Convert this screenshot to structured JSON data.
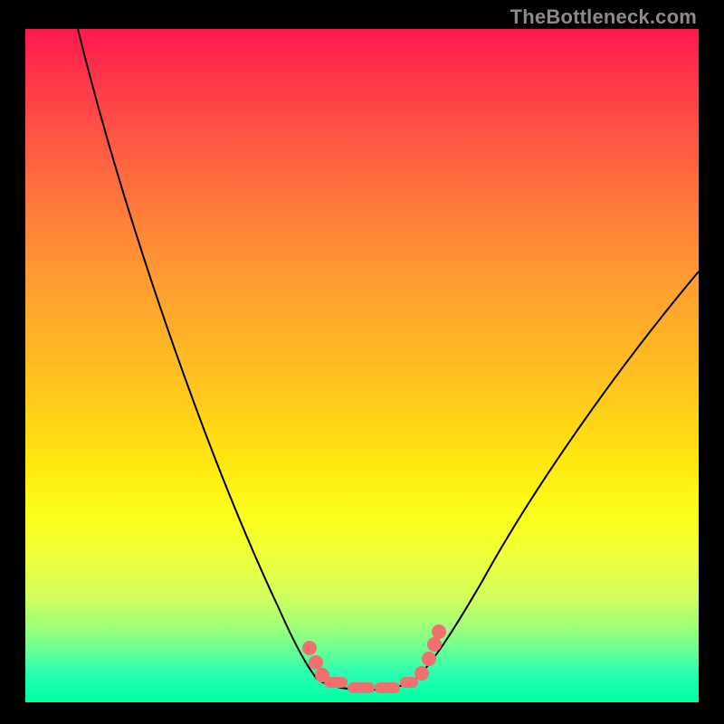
{
  "attribution": "TheBottleneck.com",
  "colors": {
    "dot": "#f07070",
    "curve": "#000000",
    "frame_border": "#000000"
  },
  "chart_data": {
    "type": "line",
    "title": "",
    "xlabel": "",
    "ylabel": "",
    "xlim": [
      0,
      100
    ],
    "ylim": [
      0,
      100
    ],
    "note": "Axes are not labeled in the source image; values are estimated on a 0–100 normalized scale where y is bottleneck percentage (0 = no bottleneck at bottom, 100 = severe at top).",
    "series": [
      {
        "name": "bottleneck-curve",
        "x": [
          8,
          12,
          16,
          20,
          24,
          28,
          32,
          36,
          40,
          42,
          44,
          46,
          50,
          54,
          58,
          60,
          62,
          66,
          72,
          80,
          90,
          100
        ],
        "y": [
          100,
          88,
          77,
          66,
          55,
          45,
          35,
          26,
          16,
          10,
          6,
          3,
          1,
          1,
          2,
          4,
          7,
          12,
          20,
          32,
          48,
          64
        ]
      }
    ],
    "highlight_band": {
      "x_start": 42,
      "x_end": 60,
      "description": "flat optimal zone near y≈0 marked with salmon dots/segments"
    },
    "markers": [
      {
        "x": 42,
        "y": 6,
        "kind": "dot"
      },
      {
        "x": 43,
        "y": 3,
        "kind": "dot"
      },
      {
        "x": 46,
        "y": 1,
        "kind": "segment"
      },
      {
        "x": 50,
        "y": 1,
        "kind": "segment"
      },
      {
        "x": 54,
        "y": 1,
        "kind": "segment"
      },
      {
        "x": 58,
        "y": 2,
        "kind": "dot"
      },
      {
        "x": 59,
        "y": 5,
        "kind": "dot"
      },
      {
        "x": 60,
        "y": 8,
        "kind": "dot"
      }
    ]
  }
}
